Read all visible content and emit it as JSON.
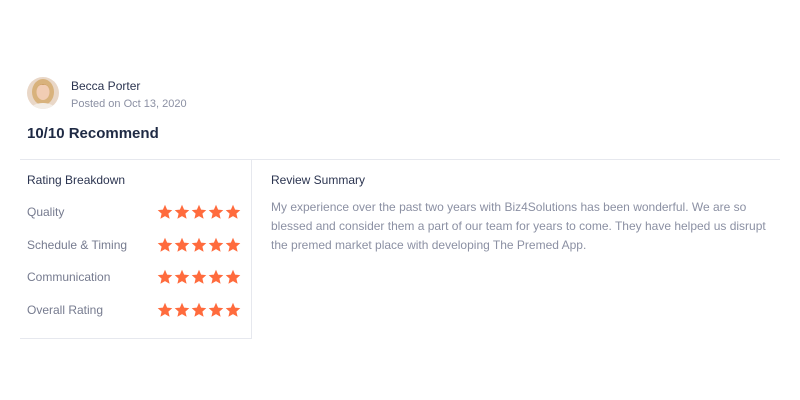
{
  "reviewer": {
    "name": "Becca Porter",
    "posted": "Posted on Oct 13, 2020"
  },
  "headline": "10/10 Recommend",
  "breakdown": {
    "title": "Rating Breakdown",
    "star_color": "#ff6b3d",
    "items": [
      {
        "label": "Quality",
        "stars": 5
      },
      {
        "label": "Schedule & Timing",
        "stars": 5
      },
      {
        "label": "Communication",
        "stars": 5
      },
      {
        "label": "Overall Rating",
        "stars": 5
      }
    ]
  },
  "summary": {
    "title": "Review Summary",
    "text": "My experience over the past two years with Biz4Solutions has been wonderful. We are so blessed and consider them a part of our team for years to come. They have helped us disrupt the premed market place with developing The Premed App."
  }
}
